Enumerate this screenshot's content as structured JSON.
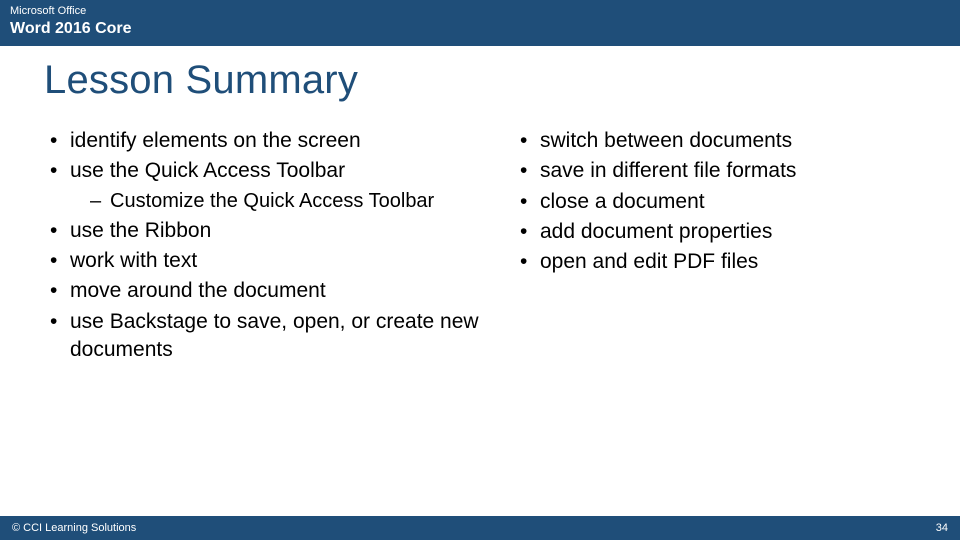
{
  "header": {
    "brand": "Microsoft Office",
    "product": "Word 2016 Core"
  },
  "title": "Lesson Summary",
  "left_column": [
    {
      "text": "identify elements on the screen",
      "sub": []
    },
    {
      "text": "use the Quick Access Toolbar",
      "sub": [
        "Customize the Quick Access Toolbar"
      ]
    },
    {
      "text": "use the Ribbon",
      "sub": []
    },
    {
      "text": "work with text",
      "sub": []
    },
    {
      "text": "move around the document",
      "sub": []
    },
    {
      "text": "use Backstage to save, open, or create new documents",
      "sub": []
    }
  ],
  "right_column": [
    {
      "text": "switch between documents"
    },
    {
      "text": "save in different file formats"
    },
    {
      "text": "close a document"
    },
    {
      "text": "add document properties"
    },
    {
      "text": "open and edit PDF files"
    }
  ],
  "footer": {
    "copyright": "© CCI Learning Solutions",
    "page_number": "34"
  }
}
